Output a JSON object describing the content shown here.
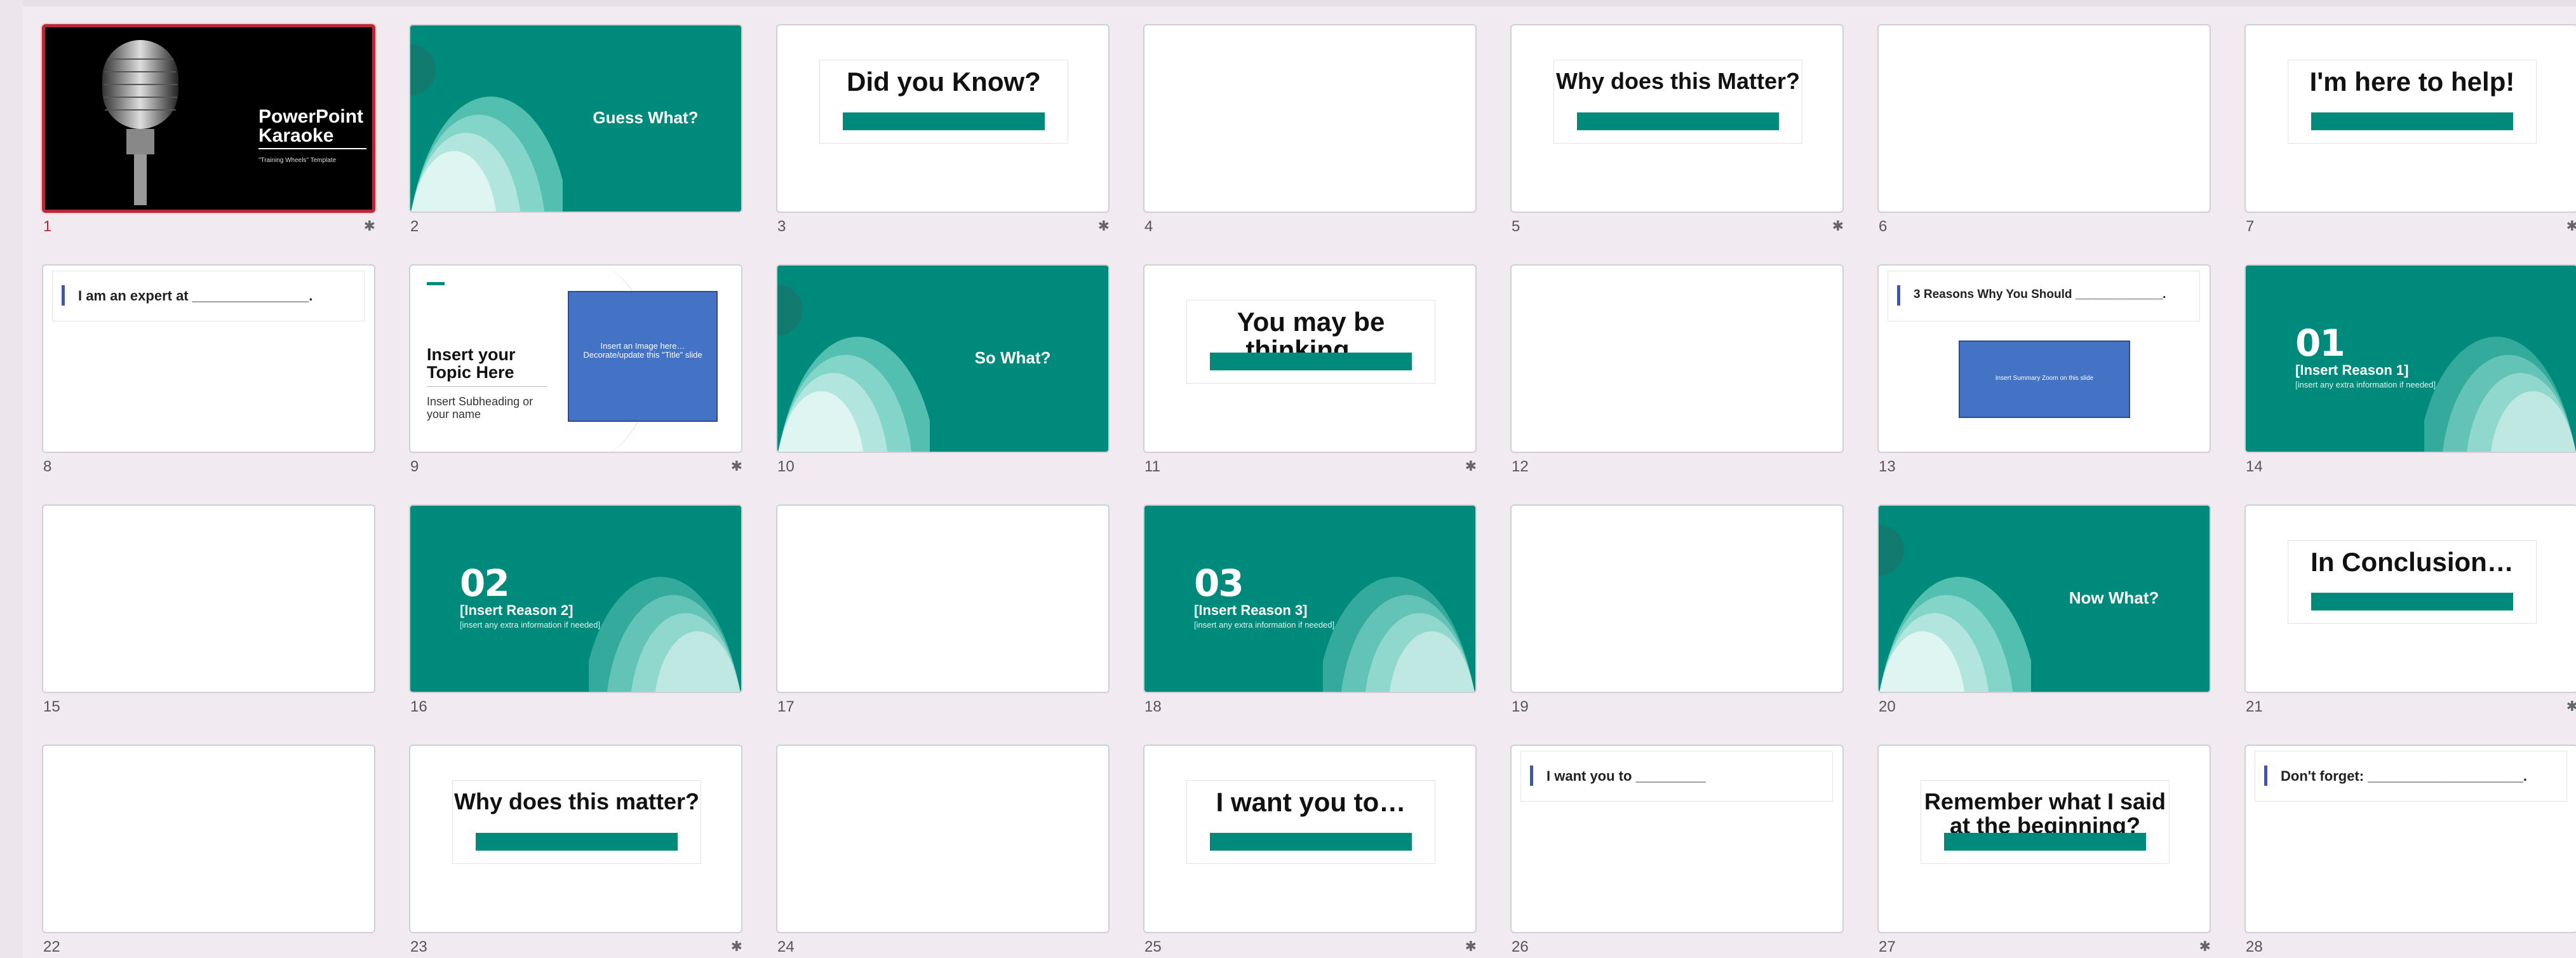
{
  "slides": [
    {
      "number": "1",
      "star": true,
      "type": "cover",
      "title": "PowerPoint Karaoke",
      "subtitle": "\"Training Wheels\" Template",
      "selected": true
    },
    {
      "number": "2",
      "star": false,
      "type": "teal-center",
      "text": "Guess What?"
    },
    {
      "number": "3",
      "star": true,
      "type": "title-box",
      "text": "Did you Know?"
    },
    {
      "number": "4",
      "star": false,
      "type": "blank"
    },
    {
      "number": "5",
      "star": true,
      "type": "title-box",
      "text": "Why does this Matter?"
    },
    {
      "number": "6",
      "star": false,
      "type": "blank"
    },
    {
      "number": "7",
      "star": true,
      "type": "title-box",
      "text": "I'm here to help!"
    },
    {
      "number": "8",
      "star": false,
      "type": "label",
      "text": "I am an expert at _______________."
    },
    {
      "number": "9",
      "star": true,
      "type": "topic",
      "title": "Insert your Topic Here",
      "subtitle": "Insert Subheading or your name",
      "image_text": "Insert an Image here… Decorate/update this \"Title\" slide"
    },
    {
      "number": "10",
      "star": false,
      "type": "teal-center",
      "text": "So What?"
    },
    {
      "number": "11",
      "star": true,
      "type": "title-box",
      "text": "You may be thinking…"
    },
    {
      "number": "12",
      "star": false,
      "type": "blank"
    },
    {
      "number": "13",
      "star": false,
      "type": "label-zoom",
      "text": "3 Reasons Why You Should _____________.",
      "box_text": "Insert Summary Zoom on this slide"
    },
    {
      "number": "14",
      "star": false,
      "type": "reason",
      "num": "01",
      "title": "[Insert Reason 1]",
      "sub": "[insert any extra information if needed]"
    },
    {
      "number": "15",
      "star": false,
      "type": "blank"
    },
    {
      "number": "16",
      "star": false,
      "type": "reason",
      "num": "02",
      "title": "[Insert Reason 2]",
      "sub": "[insert any extra information if needed]"
    },
    {
      "number": "17",
      "star": false,
      "type": "blank"
    },
    {
      "number": "18",
      "star": false,
      "type": "reason",
      "num": "03",
      "title": "[Insert Reason 3]",
      "sub": "[insert any extra information if needed]"
    },
    {
      "number": "19",
      "star": false,
      "type": "blank"
    },
    {
      "number": "20",
      "star": false,
      "type": "teal-center",
      "text": "Now What?"
    },
    {
      "number": "21",
      "star": true,
      "type": "title-box",
      "text": "In Conclusion…"
    },
    {
      "number": "22",
      "star": false,
      "type": "blank"
    },
    {
      "number": "23",
      "star": true,
      "type": "title-box",
      "text": "Why does this matter?"
    },
    {
      "number": "24",
      "star": false,
      "type": "blank"
    },
    {
      "number": "25",
      "star": true,
      "type": "title-box",
      "text": "I want you to…"
    },
    {
      "number": "26",
      "star": false,
      "type": "label",
      "text": "I want you to _________"
    },
    {
      "number": "27",
      "star": true,
      "type": "title-box",
      "text": "Remember what I said at the beginning?"
    },
    {
      "number": "28",
      "star": false,
      "type": "label",
      "text": "Don't forget: ____________________."
    }
  ],
  "icons": {
    "star": "animation-star-icon",
    "microphone": "microphone-image",
    "petals": "petal-decoration"
  },
  "colors": {
    "teal": "#008a7c",
    "selection": "#b52a36",
    "blue": "#4472c4"
  }
}
